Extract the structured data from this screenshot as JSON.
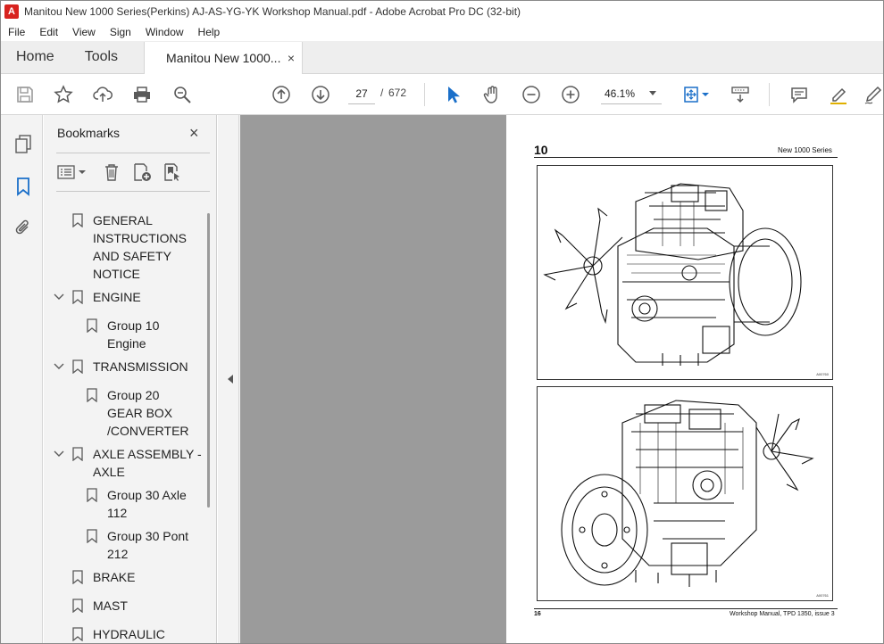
{
  "window": {
    "title": "Manitou New 1000 Series(Perkins) AJ-AS-YG-YK Workshop Manual.pdf - Adobe Acrobat Pro DC (32-bit)"
  },
  "menu": [
    "File",
    "Edit",
    "View",
    "Sign",
    "Window",
    "Help"
  ],
  "tabs": {
    "home": "Home",
    "tools": "Tools",
    "document": "Manitou New 1000...",
    "close": "×"
  },
  "toolbar": {
    "page_current": "27",
    "page_separator": "/",
    "page_total": "672",
    "zoom": "46.1%"
  },
  "bookmarks": {
    "title": "Bookmarks",
    "close": "×",
    "items": [
      {
        "label": "GENERAL\nINSTRUCTIONS\nAND SAFETY\nNOTICE",
        "level": 0,
        "expanded": null
      },
      {
        "label": "ENGINE",
        "level": 0,
        "expanded": true
      },
      {
        "label": "Group 10\nEngine",
        "level": 1,
        "expanded": null
      },
      {
        "label": "TRANSMISSION",
        "level": 0,
        "expanded": true
      },
      {
        "label": "Group  20\nGEAR BOX\n/CONVERTER",
        "level": 1,
        "expanded": null
      },
      {
        "label": "AXLE ASSEMBLY -\nAXLE",
        "level": 0,
        "expanded": true
      },
      {
        "label": "Group 30 Axle\n112",
        "level": 1,
        "expanded": null
      },
      {
        "label": "Group 30 Pont\n212",
        "level": 1,
        "expanded": null
      },
      {
        "label": "BRAKE",
        "level": 0,
        "expanded": null
      },
      {
        "label": "MAST",
        "level": 0,
        "expanded": null
      },
      {
        "label": "HYDRAULIC",
        "level": 0,
        "expanded": null
      }
    ]
  },
  "page": {
    "section_number": "10",
    "series": "New 1000 Series",
    "figure1_code": "A00760",
    "figure2_code": "A00761",
    "footer_page": "16",
    "footer_ref": "Workshop Manual, TPD 1350, issue 3"
  },
  "colors": {
    "accent_blue": "#1a6fc9",
    "icon_grey": "#5a5a5a",
    "acrobat_red": "#d8231f",
    "workspace_grey": "#9b9b9b"
  }
}
